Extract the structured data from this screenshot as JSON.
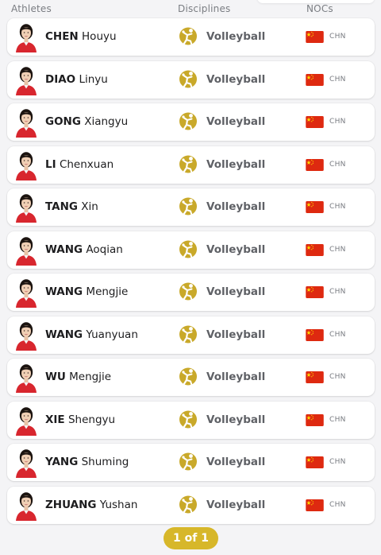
{
  "header": {
    "athletes": "Athletes",
    "disciplines": "Disciplines",
    "nocs": "NOCs"
  },
  "rows": [
    {
      "last": "CHEN",
      "first": "Houyu",
      "discipline": "Volleyball",
      "noc": "CHN"
    },
    {
      "last": "DIAO",
      "first": "Linyu",
      "discipline": "Volleyball",
      "noc": "CHN"
    },
    {
      "last": "GONG",
      "first": "Xiangyu",
      "discipline": "Volleyball",
      "noc": "CHN"
    },
    {
      "last": "LI",
      "first": "Chenxuan",
      "discipline": "Volleyball",
      "noc": "CHN"
    },
    {
      "last": "TANG",
      "first": "Xin",
      "discipline": "Volleyball",
      "noc": "CHN"
    },
    {
      "last": "WANG",
      "first": "Aoqian",
      "discipline": "Volleyball",
      "noc": "CHN"
    },
    {
      "last": "WANG",
      "first": "Mengjie",
      "discipline": "Volleyball",
      "noc": "CHN"
    },
    {
      "last": "WANG",
      "first": "Yuanyuan",
      "discipline": "Volleyball",
      "noc": "CHN"
    },
    {
      "last": "WU",
      "first": "Mengjie",
      "discipline": "Volleyball",
      "noc": "CHN"
    },
    {
      "last": "XIE",
      "first": "Shengyu",
      "discipline": "Volleyball",
      "noc": "CHN"
    },
    {
      "last": "YANG",
      "first": "Shuming",
      "discipline": "Volleyball",
      "noc": "CHN"
    },
    {
      "last": "ZHUANG",
      "first": "Yushan",
      "discipline": "Volleyball",
      "noc": "CHN"
    }
  ],
  "pager": {
    "label": "1 of 1"
  },
  "colors": {
    "accent": "#d7b72a",
    "flag_red": "#de2910",
    "flag_yellow": "#ffde00",
    "jersey_red": "#d8262e"
  },
  "icons": {
    "discipline": "volleyball-pictogram-icon",
    "flag": "china-flag-icon",
    "avatar": "athlete-headshot-avatar"
  }
}
